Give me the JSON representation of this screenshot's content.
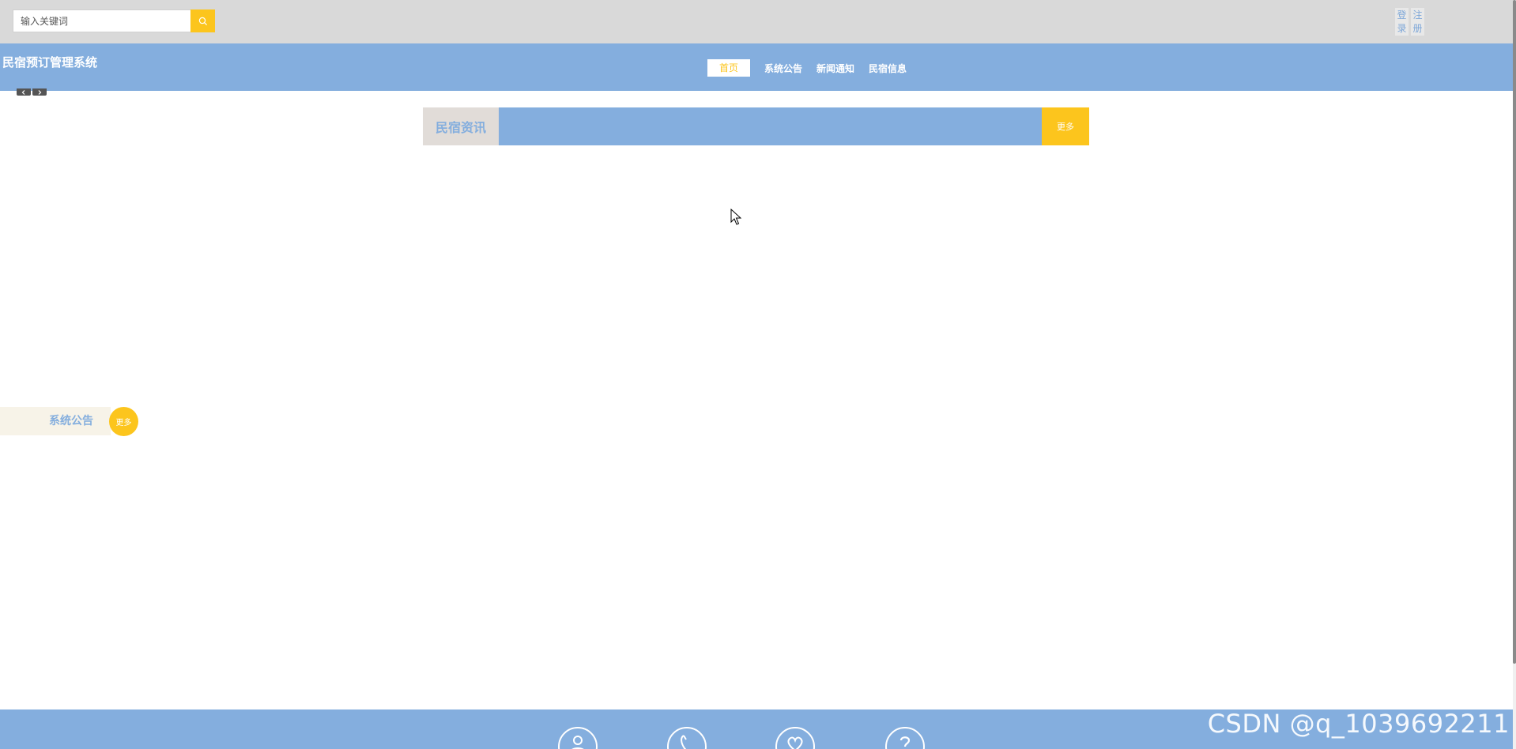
{
  "topbar": {
    "search_placeholder": "输入关键词",
    "login_label": "登录",
    "register_label": "注册"
  },
  "header": {
    "site_title": "民宿预订管理系统",
    "nav": [
      {
        "label": "首页",
        "active": true
      },
      {
        "label": "系统公告",
        "active": false
      },
      {
        "label": "新闻通知",
        "active": false
      },
      {
        "label": "民宿信息",
        "active": false
      }
    ]
  },
  "main": {
    "section_title": "民宿资讯",
    "section_more": "更多"
  },
  "notice": {
    "title": "系统公告",
    "more": "更多"
  },
  "footer": {
    "icons": [
      "user-icon",
      "phone-icon",
      "heart-icon",
      "question-icon"
    ]
  },
  "watermark": {
    "text": "CSDN @q_1039692211"
  },
  "colors": {
    "primary": "#84aede",
    "accent": "#fcc51d",
    "topbar": "#d9d9d9",
    "tab_bg": "#e1dcd8",
    "notice_bg": "#f7f3e8"
  }
}
